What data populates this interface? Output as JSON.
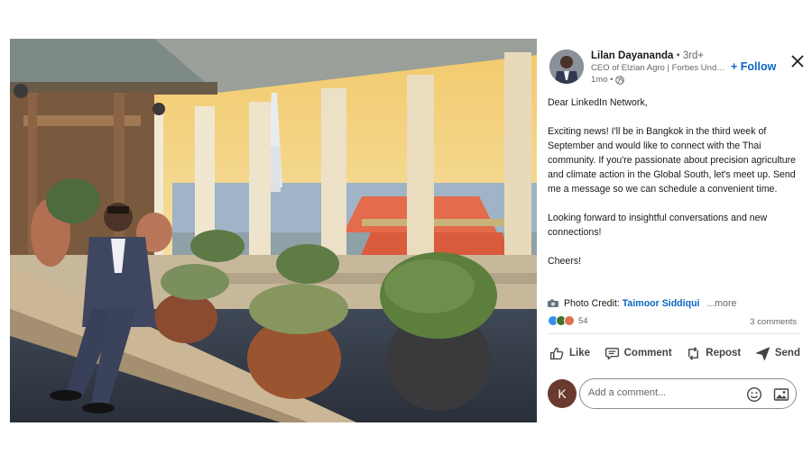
{
  "post": {
    "author": {
      "name": "Lilan Dayananda",
      "degree": "• 3rd+",
      "headline": "CEO of Elzian Agro | Forbes Under 30",
      "time": "1mo •"
    },
    "follow_label": "+ Follow",
    "body": {
      "greeting": "Dear LinkedIn Network,",
      "paragraph1": "Exciting news! I'll be in Bangkok in the third week of September and would like to connect with the Thai community. If you're passionate about precision agriculture and climate action in the Global South, let's meet up. Send me a message so we can schedule a convenient time.",
      "paragraph2": "Looking forward to insightful conversations and new connections!",
      "closing": "Cheers!"
    },
    "credit": {
      "prefix": "Photo Credit:",
      "name": "Taimoor Siddiqui",
      "more": "...more"
    },
    "reactions_count": "54",
    "comments_count": "3 comments"
  },
  "actions": {
    "like": "Like",
    "comment": "Comment",
    "repost": "Repost",
    "send": "Send"
  },
  "comment_input": {
    "avatar_letter": "K",
    "placeholder": "Add a comment..."
  },
  "icons": {
    "close": "close-icon",
    "globe": "globe-icon",
    "camera": "camera-icon",
    "like": "thumbs-up-icon",
    "comment": "speech-bubble-icon",
    "repost": "repost-arrows-icon",
    "send": "paper-plane-icon",
    "emoji": "smiley-icon",
    "image": "image-icon"
  },
  "colors": {
    "link_blue": "#0a66c2",
    "text_primary": "#191919",
    "text_secondary": "#666666",
    "reaction_like": "#378fe9",
    "reaction_celebrate": "#44712e",
    "reaction_love": "#df704d",
    "k_avatar": "#6b3a2e"
  }
}
